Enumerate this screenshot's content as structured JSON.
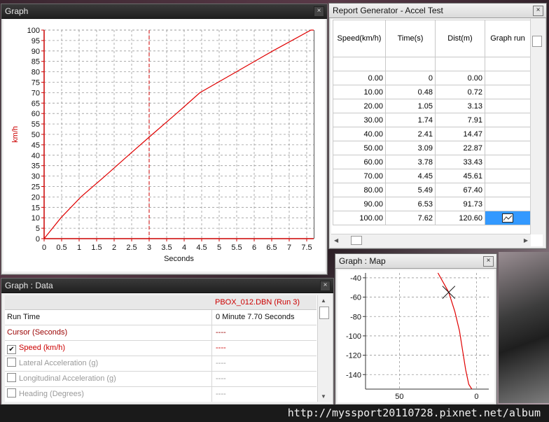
{
  "graph_window": {
    "title": "Graph",
    "close_glyph": "×",
    "chart_data": {
      "type": "line",
      "xlabel": "Seconds",
      "ylabel": "km/h",
      "xlim": [
        0,
        7.7
      ],
      "ylim": [
        0,
        100
      ],
      "x_ticks": [
        "0",
        "0.5",
        "1",
        "1.5",
        "2",
        "2.5",
        "3",
        "3.5",
        "4",
        "4.5",
        "5",
        "5.5",
        "6",
        "6.5",
        "7",
        "7.5"
      ],
      "y_ticks": [
        "0",
        "5",
        "10",
        "15",
        "20",
        "25",
        "30",
        "35",
        "40",
        "45",
        "50",
        "55",
        "60",
        "65",
        "70",
        "75",
        "80",
        "85",
        "90",
        "95",
        "100"
      ],
      "grid": true,
      "cursor_x": 3.0,
      "series": [
        {
          "x": [
            0,
            0.48,
            1.05,
            1.74,
            2.41,
            3.09,
            3.78,
            4.45,
            5.49,
            6.53,
            7.62,
            7.7
          ],
          "y": [
            0,
            10,
            20,
            30,
            40,
            50,
            60,
            70,
            80,
            90,
            100,
            100
          ],
          "color": "#e00000"
        }
      ]
    }
  },
  "report_window": {
    "title": "Report Generator - Accel Test",
    "columns": [
      "Speed(km/h)",
      "Time(s)",
      "Dist(m)",
      "Graph run"
    ],
    "rows": [
      [
        "0.00",
        "0",
        "0.00"
      ],
      [
        "10.00",
        "0.48",
        "0.72"
      ],
      [
        "20.00",
        "1.05",
        "3.13"
      ],
      [
        "30.00",
        "1.74",
        "7.91"
      ],
      [
        "40.00",
        "2.41",
        "14.47"
      ],
      [
        "50.00",
        "3.09",
        "22.87"
      ],
      [
        "60.00",
        "3.78",
        "33.43"
      ],
      [
        "70.00",
        "4.45",
        "45.61"
      ],
      [
        "80.00",
        "5.49",
        "67.40"
      ],
      [
        "90.00",
        "6.53",
        "91.73"
      ],
      [
        "100.00",
        "7.62",
        "120.60"
      ]
    ]
  },
  "data_window": {
    "title": "Graph : Data",
    "close_glyph": "×",
    "header_value": "PBOX_012.DBN (Run 3)",
    "rows": [
      {
        "label": "Run Time",
        "value": "0 Minute 7.70 Seconds",
        "color": "#111111",
        "checkbox": false
      },
      {
        "label": "Cursor (Seconds)",
        "value": "----",
        "color": "#9a0000",
        "checkbox": false
      },
      {
        "label": "Speed (km/h)",
        "value": "----",
        "color": "#cc0000",
        "checkbox": true,
        "checked": "✔"
      },
      {
        "label": "Lateral Acceleration (g)",
        "value": "----",
        "color": "#9a9a9a",
        "checkbox": true,
        "checked": ""
      },
      {
        "label": "Longitudinal Acceleration (g)",
        "value": "----",
        "color": "#9a9a9a",
        "checkbox": true,
        "checked": ""
      },
      {
        "label": "Heading (Degrees)",
        "value": "----",
        "color": "#9a9a9a",
        "checkbox": true,
        "checked": ""
      }
    ]
  },
  "map_window": {
    "title": "Graph : Map",
    "close_glyph": "×",
    "chart_data": {
      "type": "line",
      "xlim": [
        -72,
        8
      ],
      "ylim": [
        -155,
        -35
      ],
      "y_ticks": [
        -40,
        -60,
        -80,
        -100,
        -120,
        -140
      ],
      "x_ticks": [
        -50,
        0
      ],
      "x_tick_labels": [
        "50",
        "0"
      ],
      "grid": true,
      "series": [
        {
          "x": [
            -25,
            -18,
            -14,
            -11,
            -9,
            -7,
            -5,
            -3
          ],
          "y": [
            -35,
            -55,
            -75,
            -95,
            -115,
            -135,
            -150,
            -155
          ],
          "color": "#e00000"
        }
      ],
      "marker": {
        "x": -18,
        "y": -55,
        "symbol": "×"
      }
    }
  },
  "watermark": "http://myssport20110728.pixnet.net/album"
}
